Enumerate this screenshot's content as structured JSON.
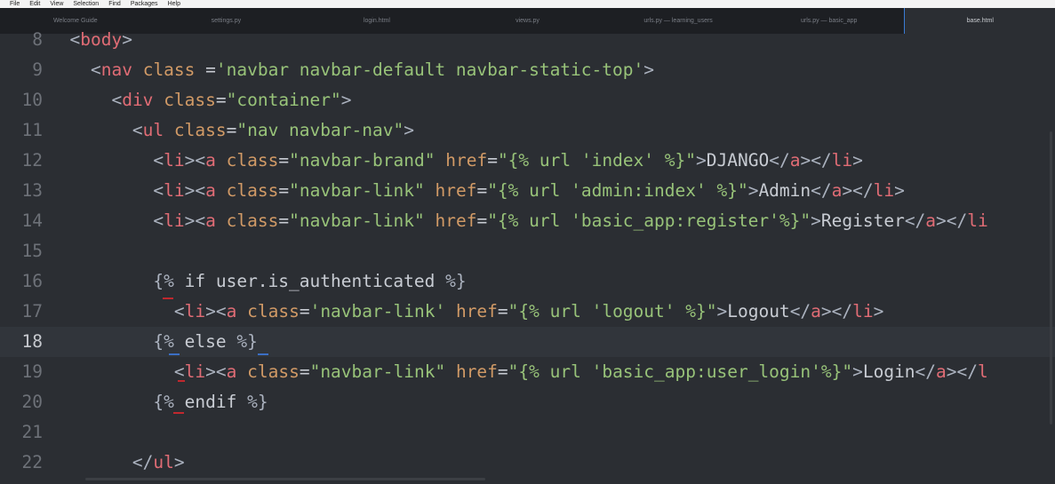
{
  "menubar": {
    "items": [
      "File",
      "Edit",
      "View",
      "Selection",
      "Find",
      "Packages",
      "Help"
    ]
  },
  "tabs": [
    {
      "label": "Welcome Guide"
    },
    {
      "label": "settings.py"
    },
    {
      "label": "login.html"
    },
    {
      "label": "views.py"
    },
    {
      "label": "urls.py — learning_users"
    },
    {
      "label": "urls.py — basic_app"
    },
    {
      "label": "base.html",
      "active": true
    }
  ],
  "editor": {
    "current_line": "18",
    "lines": [
      {
        "n": "8",
        "code": "<body>"
      },
      {
        "n": "9",
        "code": "  <nav class ='navbar navbar-default navbar-static-top'>"
      },
      {
        "n": "10",
        "code": "    <div class=\"container\">"
      },
      {
        "n": "11",
        "code": "      <ul class=\"nav navbar-nav\">"
      },
      {
        "n": "12",
        "code": "        <li><a class=\"navbar-brand\" href=\"{% url 'index' %}\">DJANGO</a></li>"
      },
      {
        "n": "13",
        "code": "        <li><a class=\"navbar-link\" href=\"{% url 'admin:index' %}\">Admin</a></li>"
      },
      {
        "n": "14",
        "code": "        <li><a class=\"navbar-link\" href=\"{% url 'basic_app:register'%}\">Register</a></li"
      },
      {
        "n": "15",
        "code": ""
      },
      {
        "n": "16",
        "code": "        {% if user.is_authenticated %}"
      },
      {
        "n": "17",
        "code": "          <li><a class='navbar-link' href=\"{% url 'logout' %}\">Logout</a></li>"
      },
      {
        "n": "18",
        "code": "        {% else %}"
      },
      {
        "n": "19",
        "code": "          <li><a class=\"navbar-link\" href=\"{% url 'basic_app:user_login'%}\">Login</a></l"
      },
      {
        "n": "20",
        "code": "        {% endif %}"
      },
      {
        "n": "21",
        "code": ""
      },
      {
        "n": "22",
        "code": "      </ul>"
      }
    ]
  }
}
